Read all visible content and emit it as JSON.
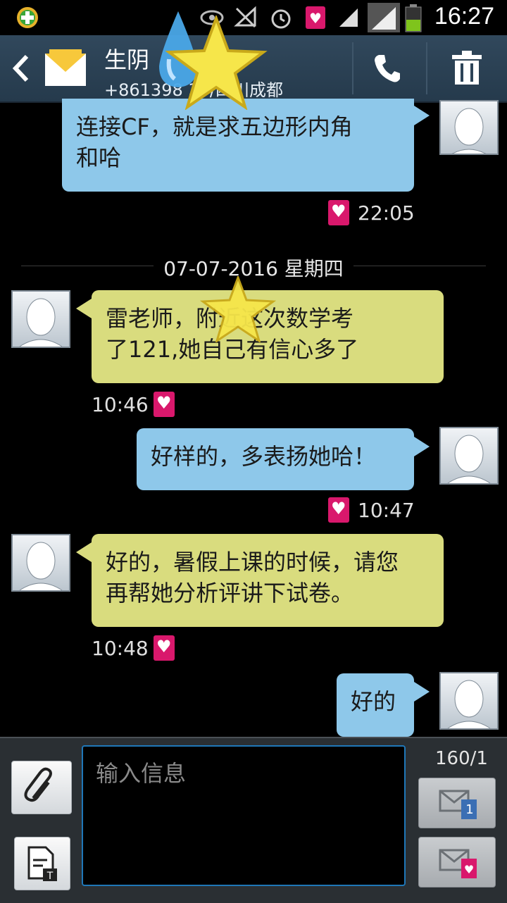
{
  "status_bar": {
    "time": "16:27"
  },
  "header": {
    "contact_name": "生阴",
    "contact_number": "+861398   35/四川成都"
  },
  "messages": [
    {
      "direction": "out",
      "text_lines": [
        "连接CF，就是求五边形内角",
        "和哈"
      ],
      "time": "22:05"
    },
    {
      "direction": "in",
      "text_lines": [
        "雷老师，附近这次数学考",
        "了121,她自己有信心多了"
      ],
      "time": "10:46"
    },
    {
      "direction": "out",
      "text_lines": [
        "好样的，多表扬她哈！"
      ],
      "time": "10:47"
    },
    {
      "direction": "in",
      "text_lines": [
        "好的，暑假上课的时候，请您",
        "再帮她分析评讲下试卷。"
      ],
      "time": "10:48"
    },
    {
      "direction": "out",
      "text_lines": [
        "好的"
      ],
      "time": ""
    }
  ],
  "date_divider": "07-07-2016 星期四",
  "composer": {
    "placeholder": "输入信息",
    "value": "",
    "char_counter": "160/1",
    "send_sim1_badge": "1"
  },
  "colors": {
    "header_bg": "#2d4458",
    "outgoing_bubble": "#8ec8ea",
    "incoming_bubble": "#d9dc7e",
    "heart_badge": "#d9186c",
    "input_border": "#1f77b8"
  },
  "icons": [
    "app-badge-icon",
    "eye-icon",
    "no-signal-icon",
    "alarm-icon",
    "heart-icon",
    "signal-icon",
    "battery-icon",
    "back-icon",
    "message-envelope-icon",
    "phone-icon",
    "trash-icon",
    "paperclip-icon",
    "template-icon",
    "send-sim1-icon",
    "send-heart-icon",
    "water-drop-icon",
    "star-icon"
  ]
}
